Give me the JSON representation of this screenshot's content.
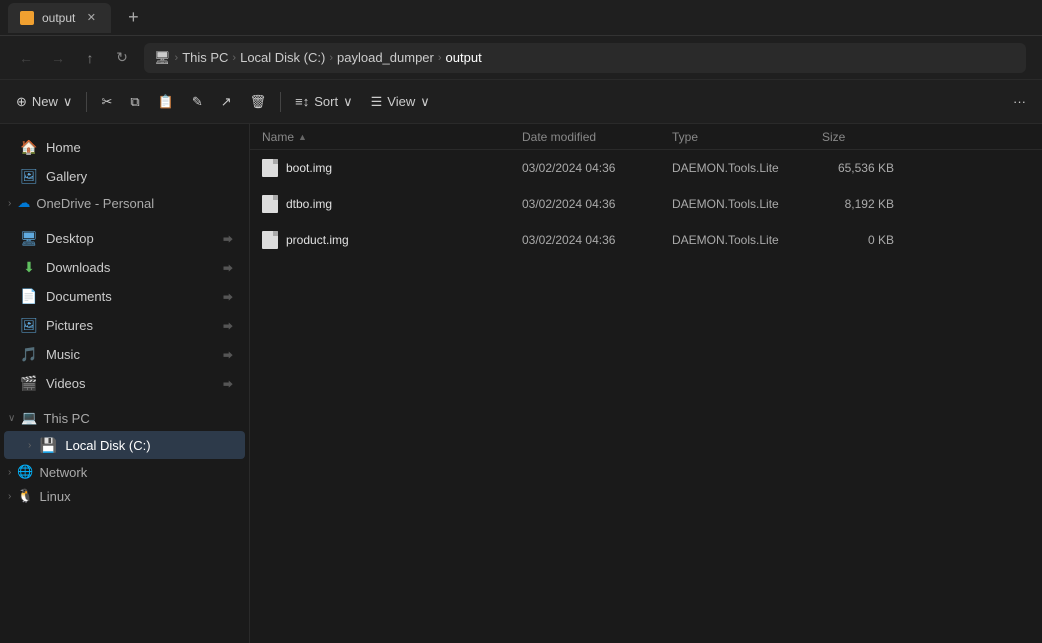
{
  "titleBar": {
    "tabLabel": "output",
    "newTabLabel": "+"
  },
  "navBar": {
    "backLabel": "←",
    "forwardLabel": "→",
    "upLabel": "↑",
    "refreshLabel": "↻",
    "breadcrumbs": [
      {
        "id": "this-pc",
        "label": "This PC",
        "icon": "pc"
      },
      {
        "id": "local-disk",
        "label": "Local Disk (C:)",
        "icon": null
      },
      {
        "id": "payload-dumper",
        "label": "payload_dumper",
        "icon": null
      },
      {
        "id": "output",
        "label": "output",
        "icon": null
      }
    ]
  },
  "toolbar": {
    "newLabel": "New",
    "newChevron": "∨",
    "cutLabel": "✂",
    "copyLabel": "⧉",
    "pasteLabel": "📋",
    "renameLabel": "✎",
    "shareLabel": "↗",
    "deleteLabel": "🗑",
    "sortLabel": "Sort",
    "sortChevron": "∨",
    "viewLabel": "View",
    "viewChevron": "∨",
    "moreLabel": "···"
  },
  "sidebar": {
    "items": [
      {
        "id": "home",
        "label": "Home",
        "icon": "🏠",
        "iconClass": "icon-home",
        "pinned": false,
        "indent": 0
      },
      {
        "id": "gallery",
        "label": "Gallery",
        "icon": "🖼",
        "iconClass": "icon-gallery",
        "pinned": false,
        "indent": 0
      },
      {
        "id": "onedrive",
        "label": "OneDrive - Personal",
        "icon": "☁",
        "iconClass": "icon-onedrive",
        "pinned": false,
        "indent": 1,
        "expanded": false
      },
      {
        "id": "desktop",
        "label": "Desktop",
        "icon": "🖥",
        "iconClass": "icon-desktop",
        "pinned": true,
        "indent": 0
      },
      {
        "id": "downloads",
        "label": "Downloads",
        "icon": "⬇",
        "iconClass": "icon-downloads",
        "pinned": true,
        "indent": 0
      },
      {
        "id": "documents",
        "label": "Documents",
        "icon": "📄",
        "iconClass": "icon-documents",
        "pinned": true,
        "indent": 0
      },
      {
        "id": "pictures",
        "label": "Pictures",
        "icon": "🖼",
        "iconClass": "icon-pictures",
        "pinned": true,
        "indent": 0
      },
      {
        "id": "music",
        "label": "Music",
        "icon": "🎵",
        "iconClass": "icon-music",
        "pinned": true,
        "indent": 0
      },
      {
        "id": "videos",
        "label": "Videos",
        "icon": "🎬",
        "iconClass": "icon-videos",
        "pinned": true,
        "indent": 0
      },
      {
        "id": "thispc",
        "label": "This PC",
        "icon": "💻",
        "iconClass": "icon-thispc",
        "pinned": false,
        "indent": 0,
        "group": true,
        "expanded": true
      },
      {
        "id": "localdisk",
        "label": "Local Disk (C:)",
        "icon": "💾",
        "iconClass": "icon-drive",
        "pinned": false,
        "indent": 1,
        "selected": true,
        "expanded": true
      },
      {
        "id": "network",
        "label": "Network",
        "icon": "🌐",
        "iconClass": "icon-network",
        "pinned": false,
        "indent": 0,
        "group": true,
        "expanded": false
      },
      {
        "id": "linux",
        "label": "Linux",
        "icon": "🐧",
        "iconClass": "icon-linux",
        "pinned": false,
        "indent": 0,
        "group": true,
        "expanded": false
      }
    ]
  },
  "fileList": {
    "columns": {
      "name": "Name",
      "dateModified": "Date modified",
      "type": "Type",
      "size": "Size"
    },
    "files": [
      {
        "name": "boot.img",
        "dateModified": "03/02/2024 04:36",
        "type": "DAEMON.Tools.Lite",
        "size": "65,536 KB"
      },
      {
        "name": "dtbo.img",
        "dateModified": "03/02/2024 04:36",
        "type": "DAEMON.Tools.Lite",
        "size": "8,192 KB"
      },
      {
        "name": "product.img",
        "dateModified": "03/02/2024 04:36",
        "type": "DAEMON.Tools.Lite",
        "size": "0 KB"
      }
    ]
  }
}
